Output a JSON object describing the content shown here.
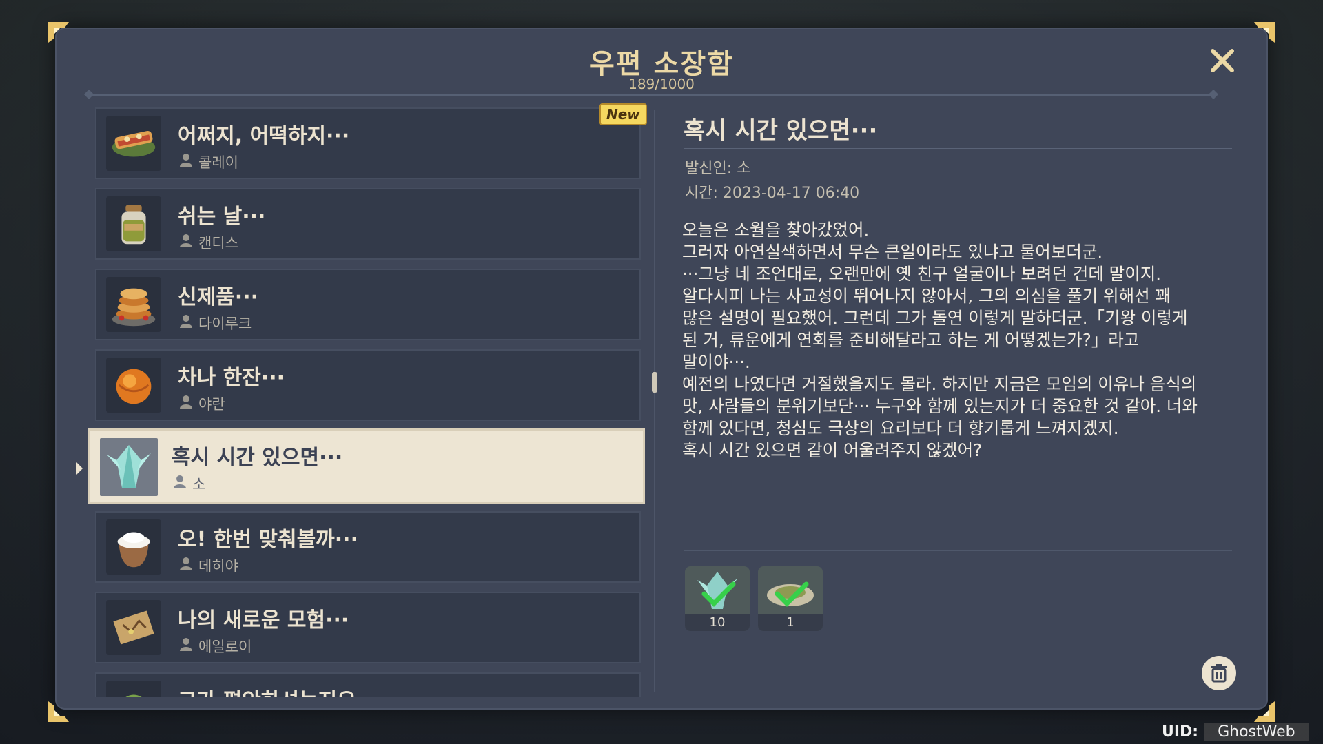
{
  "header": {
    "title": "우편 소장함",
    "count": "189/1000"
  },
  "mail_list": [
    {
      "title": "어쩌지, 어떡하지···",
      "sender": "콜레이",
      "icon": "sandwich-icon",
      "new": true
    },
    {
      "title": "쉬는 날···",
      "sender": "캔디스",
      "icon": "jar-icon",
      "new": false
    },
    {
      "title": "신제품···",
      "sender": "다이루크",
      "icon": "pancake-icon",
      "new": false
    },
    {
      "title": "차나 한잔···",
      "sender": "야란",
      "icon": "round-pastry-icon",
      "new": false
    },
    {
      "title": "혹시 시간 있으면···",
      "sender": "소",
      "icon": "crystal-leaf-icon",
      "selected": true
    },
    {
      "title": "오! 한번 맞춰볼까···",
      "sender": "데히야",
      "icon": "flour-sack-icon",
      "new": false
    },
    {
      "title": "나의 새로운 모험···",
      "sender": "에일로이",
      "icon": "map-scroll-icon",
      "new": false
    },
    {
      "title": "그가 편안하셔는지요",
      "sender": "",
      "icon": "leaf-icon",
      "new": false
    }
  ],
  "new_badge": "New",
  "detail": {
    "title": "혹시 시간 있으면···",
    "sender": "발신인: 소",
    "time": "시간: 2023-04-17 06:40",
    "body": [
      "오늘은 소월을 찾아갔었어.",
      "그러자 아연실색하면서 무슨 큰일이라도 있냐고 물어보더군.",
      "···그냥 네 조언대로, 오랜만에 옛 친구 얼굴이나 보려던 건데 말이지.",
      "알다시피 나는 사교성이 뛰어나지 않아서, 그의 의심을 풀기 위해선 꽤",
      "많은 설명이 필요했어. 그런데 그가 돌연 이렇게 말하더군.「기왕 이렇게",
      "된 거, 류운에게 연회를 준비해달라고 하는 게 어떻겠는가?」라고",
      "말이야···.",
      "예전의 나였다면 거절했을지도 몰라. 하지만 지금은 모임의 이유나 음식의",
      "맛, 사람들의 분위기보단··· 누구와 함께 있는지가 더 중요한 것 같아. 너와",
      "함께 있다면, 청심도 극상의 요리보다 더 향기롭게 느껴지겠지.",
      "혹시 시간 있으면 같이 어울려주지 않겠어?"
    ],
    "rewards": [
      {
        "icon": "crystal-leaf-icon",
        "count": "10",
        "claimed": true
      },
      {
        "icon": "dish-icon",
        "count": "1",
        "claimed": true
      }
    ]
  },
  "uid": {
    "label": "UID:",
    "value": "GhostWeb"
  },
  "colors": {
    "panel": "#3f4658",
    "title_gold": "#ecd9a6",
    "selected_bg": "#ede5d3",
    "new_badge": "#f5d860"
  }
}
